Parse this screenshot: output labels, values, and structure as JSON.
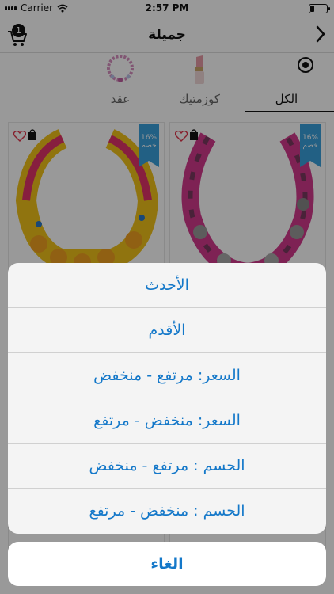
{
  "status": {
    "carrier": "Carrier",
    "time": "2:57 PM"
  },
  "nav": {
    "title": "جميلة",
    "cart_count": "1"
  },
  "categories": [
    {
      "label": "الكل",
      "selected": true
    },
    {
      "label": "كوزمتيك",
      "selected": false
    },
    {
      "label": "عقد",
      "selected": false
    }
  ],
  "products": [
    {
      "discount": "16%",
      "discount_label": "خصم"
    },
    {
      "discount": "16%",
      "discount_label": "خصم"
    }
  ],
  "sort_sheet": {
    "options": [
      "الأحدث",
      "الأقدم",
      "السعر: مرتفع - منخفض",
      "السعر: منخفض - مرتفع",
      "الحسم : مرتفع - منخفض",
      "الحسم : منخفض - مرتفع"
    ],
    "cancel": "الغاء"
  },
  "colors": {
    "accent": "#1478c9",
    "badge": "#3aa0dc"
  }
}
